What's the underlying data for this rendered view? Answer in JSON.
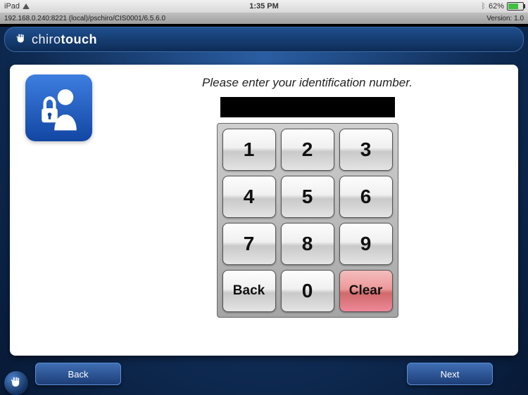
{
  "statusbar": {
    "device": "iPad",
    "time": "1:35 PM",
    "battery_pct": "62%"
  },
  "infobar": {
    "left": "192.168.0.240:8221 (local)/pschiro/CIS0001/6.5.6.0",
    "right": "Version: 1.0"
  },
  "brand": {
    "light": "chiro",
    "bold": "touch"
  },
  "main": {
    "prompt": "Please enter your identification number.",
    "display_value": "",
    "keys": {
      "k1": "1",
      "k2": "2",
      "k3": "3",
      "k4": "4",
      "k5": "5",
      "k6": "6",
      "k7": "7",
      "k8": "8",
      "k9": "9",
      "back": "Back",
      "k0": "0",
      "clear": "Clear"
    }
  },
  "nav": {
    "back": "Back",
    "next": "Next"
  },
  "icons": {
    "lock_person": "lock-person-icon",
    "hand": "hand-icon",
    "wifi": "wifi-icon",
    "bluetooth": "bluetooth-icon",
    "battery": "battery-icon"
  }
}
